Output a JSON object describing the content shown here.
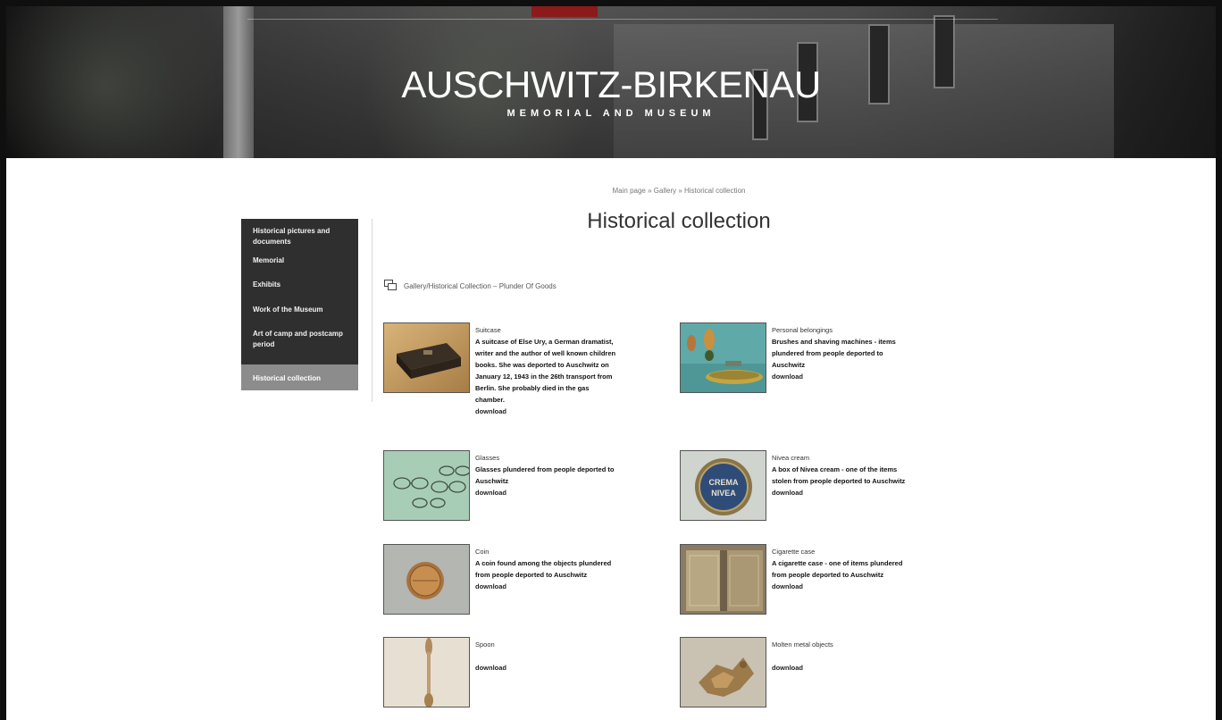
{
  "header": {
    "title": "AUSCHWITZ-BIRKENAU",
    "subtitle": "MEMORIAL AND MUSEUM"
  },
  "breadcrumb": "Main page » Gallery » Historical collection",
  "page_title": "Historical collection",
  "sidebar": {
    "items": [
      {
        "label": "Historical pictures and documents",
        "active": false
      },
      {
        "label": "Memorial",
        "active": false
      },
      {
        "label": "Exhibits",
        "active": false
      },
      {
        "label": "Work of the Museum",
        "active": false
      },
      {
        "label": "Art of camp and postcamp period",
        "active": false
      },
      {
        "label": "Historical collection",
        "active": true
      }
    ]
  },
  "gallery_path": "Gallery/Historical Collection – Plunder Of Goods",
  "items": [
    {
      "title": "Suitcase",
      "description": "A suitcase of Else Ury, a German dramatist, writer and the author of well known children books. She was deported to Auschwitz on January 12, 1943 in the 26th transport from Berlin. She probably died in the gas chamber.",
      "download": "download"
    },
    {
      "title": "Personal belongings",
      "description": "Brushes and shaving machines - items plundered from people deported to Auschwitz",
      "download": "download"
    },
    {
      "title": "Glasses",
      "description": "Glasses plundered from people deported to Auschwitz",
      "download": "download"
    },
    {
      "title": "Nivea cream",
      "description": "A box of Nivea cream - one of the items stolen from people deported to Auschwitz",
      "download": "download"
    },
    {
      "title": "Coin",
      "description": "A coin found among the objects plundered from people deported to Auschwitz",
      "download": "download"
    },
    {
      "title": "Cigarette case",
      "description": "A cigarette case - one of items plundered from people deported to Auschwitz",
      "download": "download"
    },
    {
      "title": "Spoon",
      "description": "",
      "download": "download"
    },
    {
      "title": "Molten metal objects",
      "description": "",
      "download": "download"
    }
  ],
  "nivea_label": "CREMA NIVEA",
  "colors": {
    "sidebar_bg": "#2f2f2f",
    "sidebar_active": "#8c8c8c",
    "accent_red": "#8b1a1a"
  }
}
